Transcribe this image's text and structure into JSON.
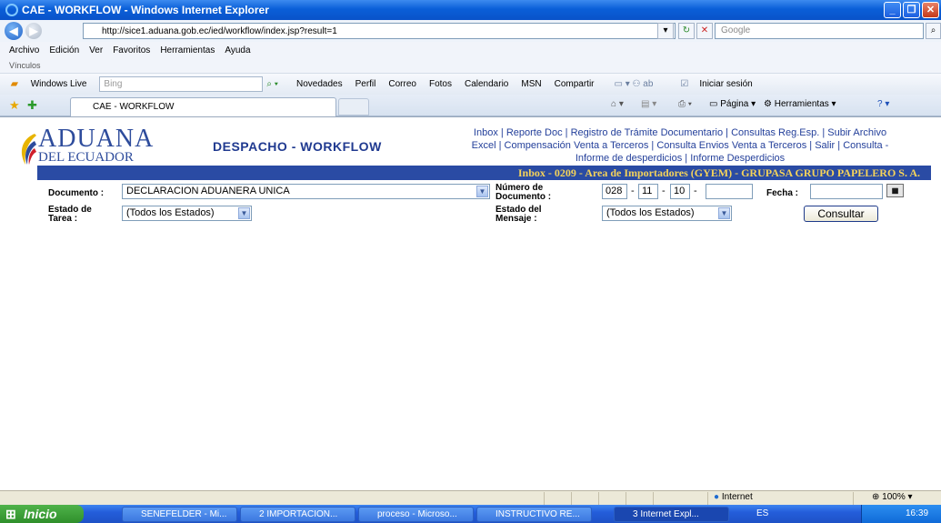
{
  "window": {
    "title": "CAE - WORKFLOW - Windows Internet Explorer",
    "min": "_",
    "max": "❐",
    "close": "✕"
  },
  "address": {
    "url": "http://sice1.aduana.gob.ec/ied/workflow/index.jsp?result=1",
    "search_placeholder": "Google"
  },
  "menu": {
    "items": [
      "Archivo",
      "Edición",
      "Ver",
      "Favoritos",
      "Herramientas",
      "Ayuda"
    ],
    "links_label": "Vínculos"
  },
  "wl": {
    "label": "Windows Live",
    "search_placeholder": "Bing",
    "items": [
      "Novedades",
      "Perfil",
      "Correo",
      "Fotos",
      "Calendario",
      "MSN",
      "Compartir"
    ],
    "signin": "Iniciar sesión"
  },
  "tabs": {
    "active": "CAE - WORKFLOW",
    "pagina": "Página",
    "herramientas": "Herramientas"
  },
  "page": {
    "logo_top": "ADUANA",
    "logo_bottom": "DEL ECUADOR",
    "app_title": "DESPACHO - WORKFLOW",
    "links": [
      "Inbox",
      "Reporte Doc",
      "Registro de Trámite Documentario",
      "Consultas Reg.Esp.",
      "Subir Archivo",
      "Excel",
      "Compensación Venta a Terceros",
      "Consulta Envios Venta a Terceros",
      "Salir",
      "Consulta -",
      "Informe de desperdicios",
      "Informe Desperdicios"
    ],
    "banner": "Inbox - 0209 - Area de Importadores (GYEM) - GRUPASA GRUPO PAPELERO S. A.",
    "documento_label": "Documento :",
    "documento_value": "DECLARACION ADUANERA UNICA",
    "numero_label_1": "Número de",
    "numero_label_2": "Documento :",
    "num1": "028",
    "num2": "11",
    "num3": "10",
    "num4": "",
    "fecha_label": "Fecha :",
    "fecha_value": "",
    "estado_tarea_1": "Estado de",
    "estado_tarea_2": "Tarea :",
    "estado_tarea_value": "(Todos los Estados)",
    "estado_msg_1": "Estado del",
    "estado_msg_2": "Mensaje :",
    "estado_msg_value": "(Todos los Estados)",
    "consultar": "Consultar"
  },
  "status": {
    "zone": "Internet",
    "zoom": "100%"
  },
  "taskbar": {
    "start": "Inicio",
    "buttons": [
      "SENEFELDER - Mi...",
      "2 IMPORTACION...",
      "proceso - Microso...",
      "INSTRUCTIVO RE...",
      "3 Internet Expl..."
    ],
    "lang": "ES",
    "time": "16:39"
  }
}
